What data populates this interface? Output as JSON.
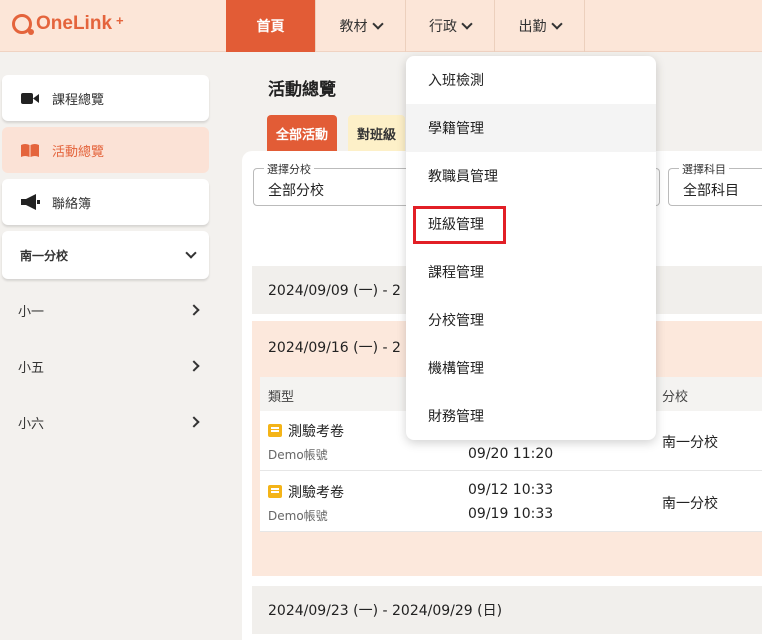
{
  "brand": {
    "name": "OneLink",
    "sup": "+"
  },
  "nav": [
    {
      "label": "首頁",
      "active": true,
      "chevron": false
    },
    {
      "label": "教材",
      "active": false,
      "chevron": true
    },
    {
      "label": "行政",
      "active": false,
      "chevron": true
    },
    {
      "label": "出勤",
      "active": false,
      "chevron": true
    }
  ],
  "sidebar": {
    "items": [
      {
        "label": "課程總覽",
        "icon": "video-camera-icon",
        "active": false
      },
      {
        "label": "活動總覽",
        "icon": "book-icon",
        "active": true
      },
      {
        "label": "聯絡簿",
        "icon": "megaphone-icon",
        "active": false
      }
    ],
    "school": "南一分校",
    "grades": [
      "小一",
      "小五",
      "小六"
    ]
  },
  "main": {
    "title": "活動總覽",
    "tabs": [
      "全部活動",
      "對班級"
    ],
    "filters": {
      "school_label": "選擇分校",
      "school_value": "全部分校",
      "subject_label": "選擇科目",
      "subject_value": "全部科目"
    },
    "weeks": [
      "2024/09/09 (一) - 2",
      "2024/09/16 (一) - 2",
      "2024/09/23 (一) - 2024/09/29 (日)"
    ],
    "table": {
      "col_type": "類型",
      "col_school": "分校",
      "rows": [
        {
          "type": "測驗考卷",
          "owner": "Demo帳號",
          "start": "",
          "end": "09/20 11:20",
          "school": "南一分校"
        },
        {
          "type": "測驗考卷",
          "owner": "Demo帳號",
          "start": "09/12 10:33",
          "end": "09/19 10:33",
          "school": "南一分校"
        }
      ]
    }
  },
  "dropdown": {
    "items": [
      "入班檢測",
      "學籍管理",
      "教職員管理",
      "班級管理",
      "課程管理",
      "分校管理",
      "機構管理",
      "財務管理"
    ],
    "hovered_index": 1,
    "highlighted_index": 3
  },
  "colors": {
    "accent": "#e25c36",
    "highlight_box": "#e21f26"
  }
}
